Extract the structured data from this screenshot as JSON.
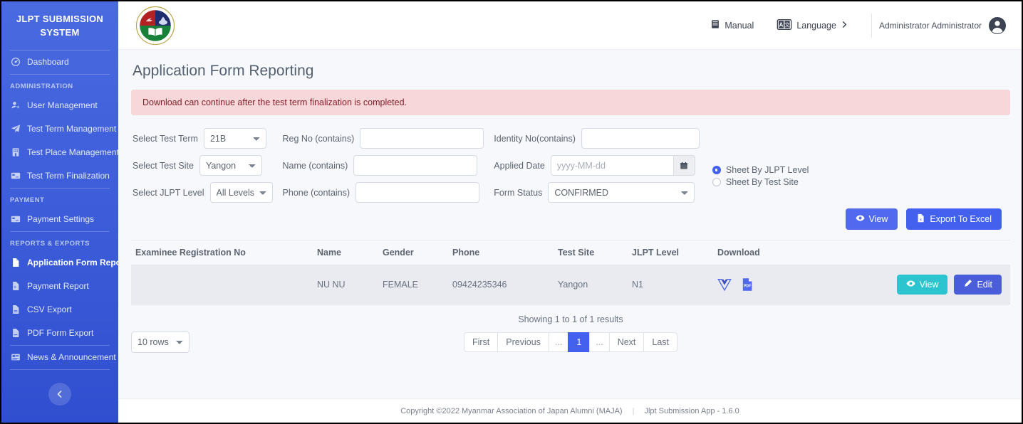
{
  "sidebar": {
    "brand": "JLPT SUBMISSION SYSTEM",
    "items": [
      {
        "label": "Dashboard",
        "icon": "dashboard-icon"
      }
    ],
    "sections": [
      {
        "title": "ADMINISTRATION",
        "items": [
          {
            "label": "User Management",
            "icon": "user-add-icon"
          },
          {
            "label": "Test Term Management",
            "icon": "paper-plane-icon"
          },
          {
            "label": "Test Place Management",
            "icon": "building-icon"
          },
          {
            "label": "Test Term Finalization",
            "icon": "card-icon"
          }
        ]
      },
      {
        "title": "PAYMENT",
        "items": [
          {
            "label": "Payment Settings",
            "icon": "card-icon"
          }
        ]
      },
      {
        "title": "REPORTS & EXPORTS",
        "items": [
          {
            "label": "Application Form Report",
            "icon": "file-icon",
            "active": true
          },
          {
            "label": "Payment Report",
            "icon": "file-icon"
          },
          {
            "label": "CSV Export",
            "icon": "file-icon"
          },
          {
            "label": "PDF Form Export",
            "icon": "file-icon"
          },
          {
            "label": "News & Announcement",
            "icon": "news-icon"
          }
        ]
      }
    ],
    "collapse_label": "collapse-sidebar"
  },
  "topbar": {
    "logo_alt": "maja-crest-logo",
    "manual_label": "Manual",
    "language_label": "Language",
    "user_name": "Administrator Administrator"
  },
  "page": {
    "title": "Application Form Reporting",
    "alert": "Download can continue after the test term finalization is completed."
  },
  "filters": {
    "test_term_label": "Select Test Term",
    "test_term_value": "21B",
    "test_site_label": "Select Test Site",
    "test_site_value": "Yangon",
    "jlpt_level_label": "Select JLPT Level",
    "jlpt_level_value": "All Levels",
    "reg_no_label": "Reg No (contains)",
    "reg_no_value": "",
    "name_label": "Name (contains)",
    "name_value": "",
    "phone_label": "Phone (contains)",
    "phone_value": "",
    "identity_no_label": "Identity No(contains)",
    "identity_no_value": "",
    "applied_date_label": "Applied Date",
    "applied_date_placeholder": "yyyy-MM-dd",
    "applied_date_value": "",
    "form_status_label": "Form Status",
    "form_status_value": "CONFIRMED",
    "radio_jlpt_level": "Sheet By JLPT Level",
    "radio_test_site": "Sheet By Test Site",
    "radio_selected": "Sheet By JLPT Level",
    "view_button": "View",
    "export_button": "Export To Excel"
  },
  "table": {
    "columns": [
      "Examinee Registration No",
      "Name",
      "Gender",
      "Phone",
      "Test Site",
      "JLPT Level",
      "Download"
    ],
    "rows": [
      {
        "reg_no": "",
        "name": "NU NU",
        "gender": "FEMALE",
        "phone": "09424235346",
        "test_site": "Yangon",
        "jlpt_level": "N1",
        "downloads": [
          "vue-word-icon",
          "pdf-icon"
        ],
        "view_label": "View",
        "edit_label": "Edit"
      }
    ]
  },
  "pagination": {
    "showing": "Showing 1 to 1 of 1 results",
    "rows_per_page": "10 rows",
    "first": "First",
    "previous": "Previous",
    "dots_left": "...",
    "current": "1",
    "dots_right": "...",
    "next": "Next",
    "last": "Last"
  },
  "footer": {
    "copyright": "Copyright ©2022 Myanmar Association of Japan Alumni (MAJA)",
    "separator": "|",
    "version": "Jlpt Submission App - 1.6.0"
  },
  "colors": {
    "sidebar": "#3f5fdb",
    "primary": "#4361ee",
    "view_teal": "#2bc4cf",
    "edit_indigo": "#4a5ddb",
    "alert_bg": "#f8d7da",
    "alert_text": "#842029",
    "row_bg": "#e9ebf0",
    "page_bg": "#f6f8fc"
  }
}
